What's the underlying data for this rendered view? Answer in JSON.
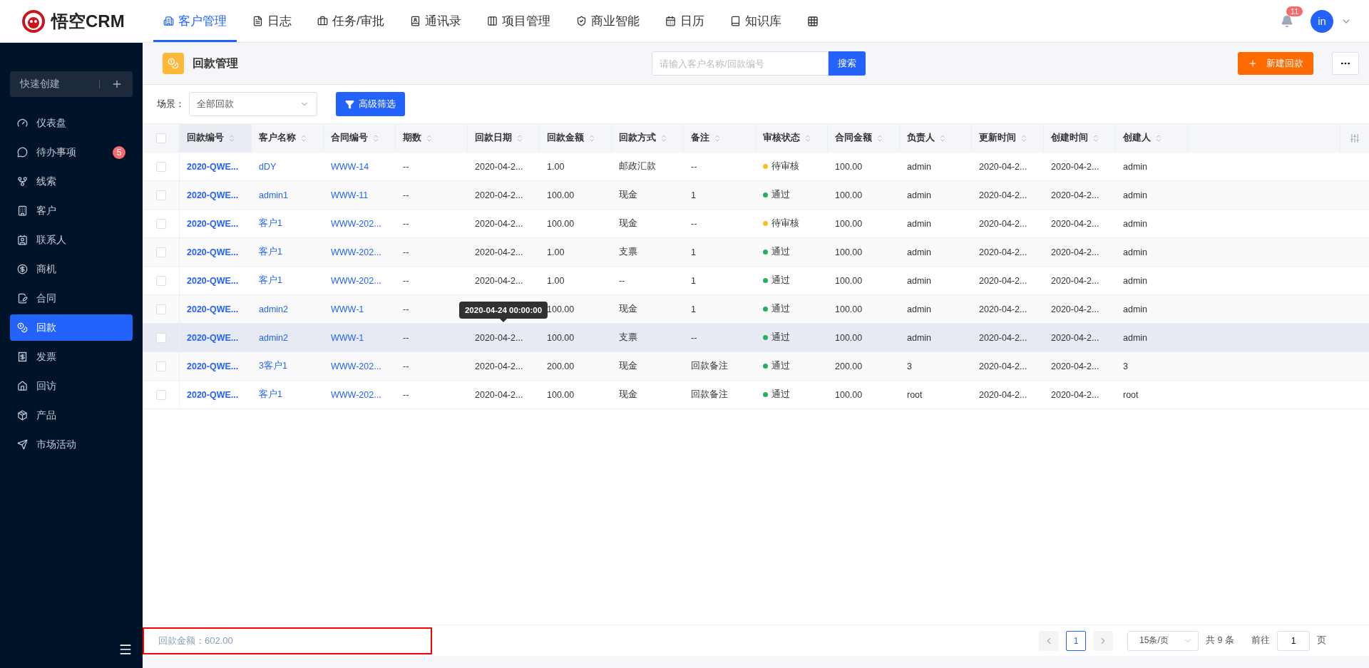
{
  "topbar": {
    "logo": "悟空CRM",
    "nav": [
      {
        "label": "客户管理",
        "selected": true
      },
      {
        "label": "日志",
        "selected": false
      },
      {
        "label": "任务/审批",
        "selected": false
      },
      {
        "label": "通讯录",
        "selected": false
      },
      {
        "label": "项目管理",
        "selected": false
      },
      {
        "label": "商业智能",
        "selected": false
      },
      {
        "label": "日历",
        "selected": false
      },
      {
        "label": "知识库",
        "selected": false
      }
    ],
    "notification_count": "11",
    "avatar": "in"
  },
  "sidebar": {
    "quick_create": "快速创建",
    "items": [
      {
        "label": "仪表盘",
        "selected": false
      },
      {
        "label": "待办事项",
        "selected": false,
        "badge": "5"
      },
      {
        "label": "线索",
        "selected": false
      },
      {
        "label": "客户",
        "selected": false
      },
      {
        "label": "联系人",
        "selected": false
      },
      {
        "label": "商机",
        "selected": false
      },
      {
        "label": "合同",
        "selected": false
      },
      {
        "label": "回款",
        "selected": true
      },
      {
        "label": "发票",
        "selected": false
      },
      {
        "label": "回访",
        "selected": false
      },
      {
        "label": "产品",
        "selected": false
      },
      {
        "label": "市场活动",
        "selected": false
      }
    ]
  },
  "header": {
    "title": "回款管理",
    "search": {
      "placeholder": "请输入客户名称/回款编号"
    },
    "search_button": "搜索",
    "new_button": "新建回款"
  },
  "filter": {
    "scene_label": "场景：",
    "scene_value": "全部回款",
    "advanced_button": "高级筛选"
  },
  "table": {
    "all_checked": false,
    "columns": [
      {
        "label": "回款编号",
        "kind": "strong-link"
      },
      {
        "label": "客户名称",
        "kind": "link"
      },
      {
        "label": "合同编号",
        "kind": "link"
      },
      {
        "label": "期数",
        "kind": "text"
      },
      {
        "label": "回款日期",
        "kind": "text"
      },
      {
        "label": "回款金额",
        "kind": "text"
      },
      {
        "label": "回款方式",
        "kind": "text"
      },
      {
        "label": "备注",
        "kind": "text"
      },
      {
        "label": "审核状态",
        "kind": "status"
      },
      {
        "label": "合同金额",
        "kind": "text"
      },
      {
        "label": "负责人",
        "kind": "text"
      },
      {
        "label": "更新时间",
        "kind": "text"
      },
      {
        "label": "创建时间",
        "kind": "text"
      },
      {
        "label": "创建人",
        "kind": "text"
      }
    ],
    "rows": [
      {
        "checked": false,
        "hovered": false,
        "cells": [
          "2020-QWE...",
          "dDY",
          "WWW-14",
          "--",
          "2020-04-2...",
          "1.00",
          "邮政汇款",
          "--",
          {
            "label": "待审核",
            "color": "#fbbf24"
          },
          "100.00",
          "admin",
          "2020-04-2...",
          "2020-04-2...",
          "admin"
        ]
      },
      {
        "checked": false,
        "hovered": false,
        "cells": [
          "2020-QWE...",
          "admin1",
          "WWW-11",
          "--",
          "2020-04-2...",
          "100.00",
          "现金",
          "1",
          {
            "label": "通过",
            "color": "#22b35e"
          },
          "100.00",
          "admin",
          "2020-04-2...",
          "2020-04-2...",
          "admin"
        ]
      },
      {
        "checked": false,
        "hovered": false,
        "cells": [
          "2020-QWE...",
          "客户1",
          "WWW-202...",
          "--",
          "2020-04-2...",
          "100.00",
          "现金",
          "--",
          {
            "label": "待审核",
            "color": "#fbbf24"
          },
          "100.00",
          "admin",
          "2020-04-2...",
          "2020-04-2...",
          "admin"
        ]
      },
      {
        "checked": false,
        "hovered": false,
        "cells": [
          "2020-QWE...",
          "客户1",
          "WWW-202...",
          "--",
          "2020-04-2...",
          "1.00",
          "支票",
          "1",
          {
            "label": "通过",
            "color": "#22b35e"
          },
          "100.00",
          "admin",
          "2020-04-2...",
          "2020-04-2...",
          "admin"
        ]
      },
      {
        "checked": false,
        "hovered": false,
        "cells": [
          "2020-QWE...",
          "客户1",
          "WWW-202...",
          "--",
          "2020-04-2...",
          "1.00",
          "--",
          "1",
          {
            "label": "通过",
            "color": "#22b35e"
          },
          "100.00",
          "admin",
          "2020-04-2...",
          "2020-04-2...",
          "admin"
        ]
      },
      {
        "checked": false,
        "hovered": false,
        "cells": [
          "2020-QWE...",
          "admin2",
          "WWW-1",
          "--",
          null,
          "100.00",
          "现金",
          "1",
          {
            "label": "通过",
            "color": "#22b35e"
          },
          "100.00",
          "admin",
          "2020-04-2...",
          "2020-04-2...",
          "admin"
        ]
      },
      {
        "checked": false,
        "hovered": true,
        "tooltip": "2020-04-24 00:00:00",
        "cells": [
          "2020-QWE...",
          "admin2",
          "WWW-1",
          "--",
          "2020-04-2...",
          "100.00",
          "支票",
          "--",
          {
            "label": "通过",
            "color": "#22b35e"
          },
          "100.00",
          "admin",
          "2020-04-2...",
          "2020-04-2...",
          "admin"
        ]
      },
      {
        "checked": false,
        "hovered": false,
        "cells": [
          "2020-QWE...",
          "3客户1",
          "WWW-202...",
          "--",
          "2020-04-2...",
          "200.00",
          "现金",
          "回款备注",
          {
            "label": "通过",
            "color": "#22b35e"
          },
          "200.00",
          "3",
          "2020-04-2...",
          "2020-04-2...",
          "3"
        ]
      },
      {
        "checked": false,
        "hovered": false,
        "cells": [
          "2020-QWE...",
          "客户1",
          "WWW-202...",
          "--",
          "2020-04-2...",
          "100.00",
          "现金",
          "回款备注",
          {
            "label": "通过",
            "color": "#22b35e"
          },
          "100.00",
          "root",
          "2020-04-2...",
          "2020-04-2...",
          "root"
        ]
      }
    ]
  },
  "footer": {
    "summary": "回款金额：602.00",
    "pages": [
      {
        "label": "1",
        "selected": true
      }
    ],
    "page_size": "15条/页",
    "total": "共 9 条",
    "goto_label": "前往",
    "goto_value": "1",
    "goto_suffix": "页"
  }
}
